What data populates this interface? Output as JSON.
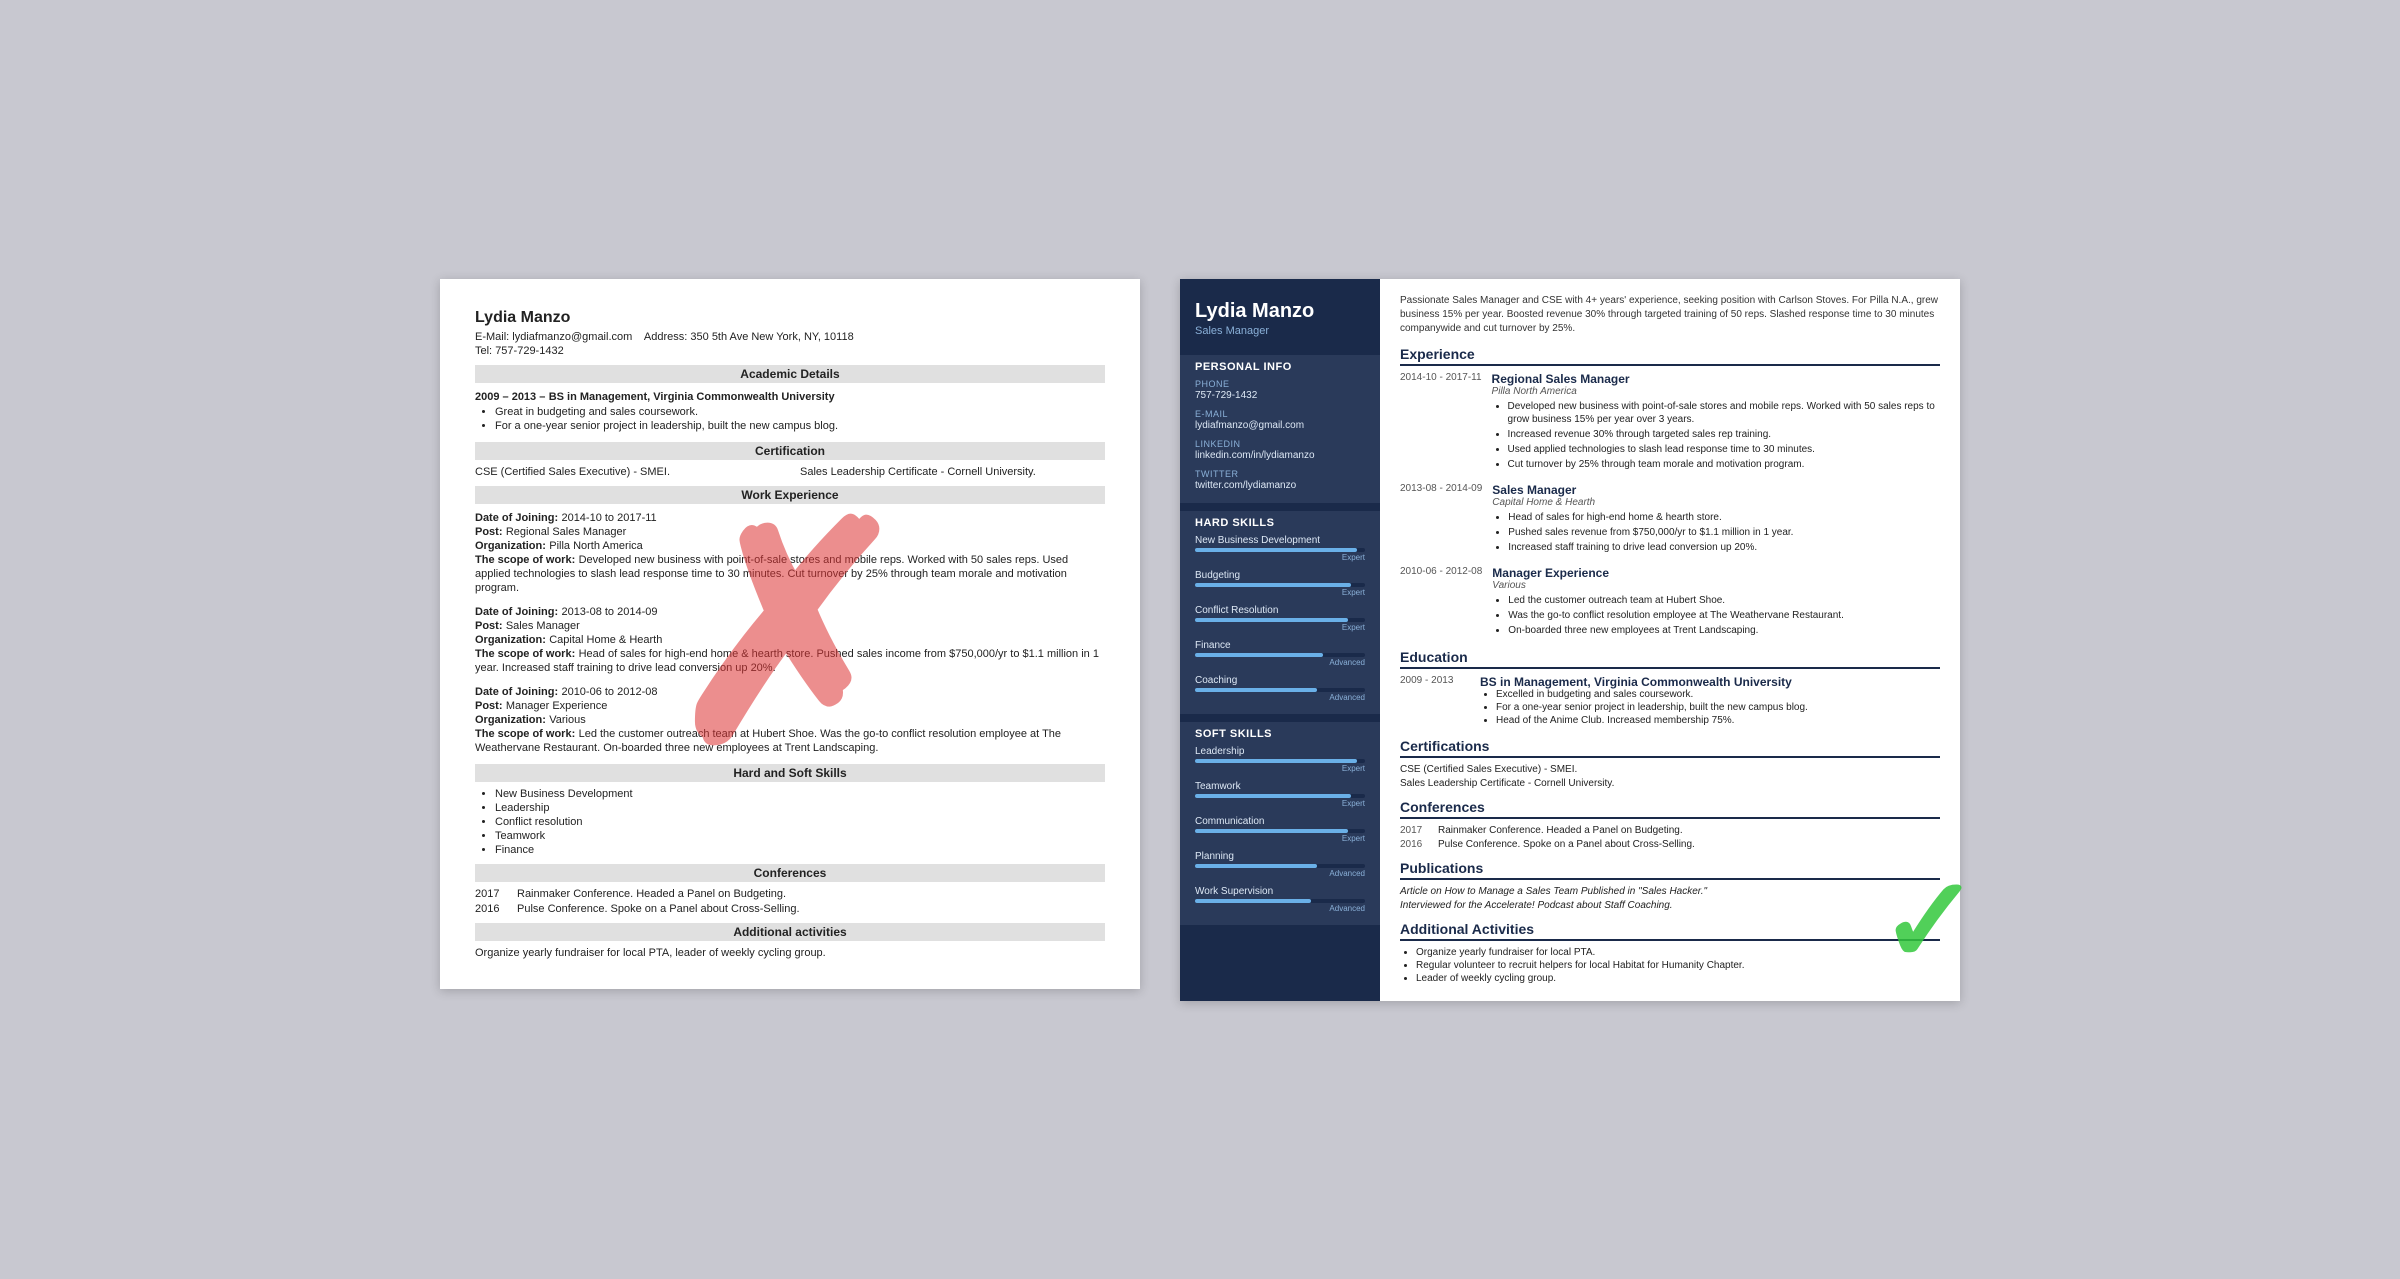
{
  "left_resume": {
    "name": "Lydia Manzo",
    "email_label": "E-Mail:",
    "email": "lydiafmanzo@gmail.com",
    "address_label": "Address:",
    "address": "350 5th Ave New York, NY, 10118",
    "tel_label": "Tel:",
    "tel": "757-729-1432",
    "sections": {
      "academic": "Academic Details",
      "certification": "Certification",
      "work": "Work Experience",
      "skills": "Hard and Soft Skills",
      "conferences": "Conferences",
      "additional": "Additional activities"
    },
    "education": {
      "dates": "2009 – 2013 –",
      "degree": "BS in Management, Virginia Commonwealth University",
      "bullets": [
        "Great in budgeting and sales coursework.",
        "For a one-year senior project in leadership, built the new campus blog."
      ]
    },
    "certifications": [
      "CSE (Certified Sales Executive) - SMEI.",
      "Sales Leadership Certificate - Cornell University."
    ],
    "experience": [
      {
        "joining": "2014-10 to 2017-11",
        "post": "Regional Sales Manager",
        "org": "Pilla North America",
        "scope": "Developed new business with point-of-sale stores and mobile reps. Worked with 50 sales reps. Used applied technologies to slash lead response time to 30 minutes. Cut turnover by 25% through team morale and motivation program."
      },
      {
        "joining": "2013-08 to 2014-09",
        "post": "Sales Manager",
        "org": "Capital Home & Hearth",
        "scope": "Head of sales for high-end home & hearth store. Pushed sales income from $750,000/yr to $1.1 million in 1 year. Increased staff training to drive lead conversion up 20%."
      },
      {
        "joining": "2010-06 to 2012-08",
        "post": "Manager Experience",
        "org": "Various",
        "scope": "Led the customer outreach team at Hubert Shoe. Was the go-to conflict resolution employee at The Weathervane Restaurant. On-boarded three new employees at Trent Landscaping."
      }
    ],
    "skills": [
      "New Business Development",
      "Leadership",
      "Conflict resolution",
      "Teamwork",
      "Finance"
    ],
    "conferences": [
      {
        "year": "2017",
        "text": "Rainmaker Conference. Headed a Panel on Budgeting."
      },
      {
        "year": "2016",
        "text": "Pulse Conference. Spoke on a Panel about Cross-Selling."
      }
    ],
    "additional": "Organize yearly fundraiser for local PTA, leader of weekly cycling group."
  },
  "right_resume": {
    "name": "Lydia Manzo",
    "title": "Sales Manager",
    "summary": "Passionate Sales Manager and CSE with 4+ years' experience, seeking position with Carlson Stoves. For Pilla N.A., grew business 15% per year. Boosted revenue 30% through targeted training of 50 reps. Slashed response time to 30 minutes companywide and cut turnover by 25%.",
    "personal": {
      "phone_label": "Phone",
      "phone": "757-729-1432",
      "email_label": "E-mail",
      "email": "lydiafmanzo@gmail.com",
      "linkedin_label": "LinkedIn",
      "linkedin": "linkedin.com/in/lydiamanzo",
      "twitter_label": "Twitter",
      "twitter": "twitter.com/lydiamanzo"
    },
    "hard_skills": [
      {
        "name": "New Business Development",
        "pct": 95,
        "level": "Expert"
      },
      {
        "name": "Budgeting",
        "pct": 92,
        "level": "Expert"
      },
      {
        "name": "Conflict Resolution",
        "pct": 90,
        "level": "Expert"
      },
      {
        "name": "Finance",
        "pct": 75,
        "level": "Advanced"
      },
      {
        "name": "Coaching",
        "pct": 72,
        "level": "Advanced"
      }
    ],
    "soft_skills": [
      {
        "name": "Leadership",
        "pct": 95,
        "level": "Expert"
      },
      {
        "name": "Teamwork",
        "pct": 92,
        "level": "Expert"
      },
      {
        "name": "Communication",
        "pct": 90,
        "level": "Expert"
      },
      {
        "name": "Planning",
        "pct": 72,
        "level": "Advanced"
      },
      {
        "name": "Work Supervision",
        "pct": 68,
        "level": "Advanced"
      }
    ],
    "sections": {
      "experience": "Experience",
      "education": "Education",
      "certifications": "Certifications",
      "conferences": "Conferences",
      "publications": "Publications",
      "additional": "Additional Activities"
    },
    "experience": [
      {
        "dates": "2014-10 - 2017-11",
        "title": "Regional Sales Manager",
        "company": "Pilla North America",
        "bullets": [
          "Developed new business with point-of-sale stores and mobile reps. Worked with 50 sales reps to grow business 15% per year over 3 years.",
          "Increased revenue 30% through targeted sales rep training.",
          "Used applied technologies to slash lead response time to 30 minutes.",
          "Cut turnover by 25% through team morale and motivation program."
        ]
      },
      {
        "dates": "2013-08 - 2014-09",
        "title": "Sales Manager",
        "company": "Capital Home & Hearth",
        "bullets": [
          "Head of sales for high-end home & hearth store.",
          "Pushed sales revenue from $750,000/yr to $1.1 million in 1 year.",
          "Increased staff training to drive lead conversion up 20%."
        ]
      },
      {
        "dates": "2010-06 - 2012-08",
        "title": "Manager Experience",
        "company": "Various",
        "bullets": [
          "Led the customer outreach team at Hubert Shoe.",
          "Was the go-to conflict resolution employee at The Weathervane Restaurant.",
          "On-boarded three new employees at Trent Landscaping."
        ]
      }
    ],
    "education": [
      {
        "dates": "2009 - 2013",
        "title": "BS in Management, Virginia Commonwealth University",
        "bullets": [
          "Excelled in budgeting and sales coursework.",
          "For a one-year senior project in leadership, built the new campus blog.",
          "Head of the Anime Club. Increased membership 75%."
        ]
      }
    ],
    "certifications": [
      "CSE (Certified Sales Executive) - SMEI.",
      "Sales Leadership Certificate - Cornell University."
    ],
    "conferences": [
      {
        "year": "2017",
        "text": "Rainmaker Conference. Headed a Panel on Budgeting."
      },
      {
        "year": "2016",
        "text": "Pulse Conference. Spoke on a Panel about Cross-Selling."
      }
    ],
    "publications": [
      "Article on How to Manage a Sales Team Published in \"Sales Hacker.\"",
      "Interviewed for the Accelerate! Podcast about Staff Coaching."
    ],
    "additional_bullets": [
      "Organize yearly fundraiser for local PTA.",
      "Regular volunteer to recruit helpers for local Habitat for Humanity Chapter.",
      "Leader of weekly cycling group."
    ]
  }
}
